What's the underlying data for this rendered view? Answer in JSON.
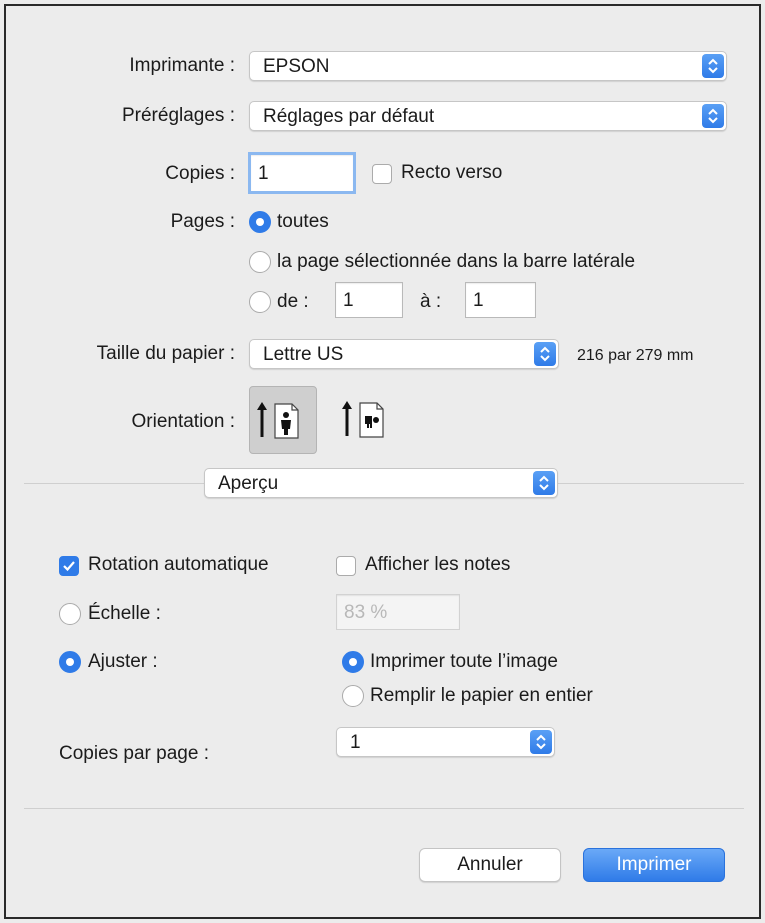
{
  "printer": {
    "label": "Imprimante :",
    "value": "EPSON"
  },
  "presets": {
    "label": "Préréglages :",
    "value": "Réglages par défaut"
  },
  "copies": {
    "label": "Copies :",
    "value": "1",
    "duplex_label": "Recto verso",
    "duplex_checked": false
  },
  "pages": {
    "label": "Pages :",
    "all_label": "toutes",
    "selected_label": "la page sélectionnée dans la barre latérale",
    "from_label": "de :",
    "from_value": "1",
    "to_label": "à :",
    "to_value": "1",
    "selected_option": "toutes"
  },
  "paper_size": {
    "label": "Taille du papier :",
    "value": "Lettre US",
    "dimensions": "216 par 279 mm"
  },
  "orientation": {
    "label": "Orientation :",
    "options": [
      "portrait",
      "landscape"
    ],
    "selected": "portrait"
  },
  "section": {
    "value": "Aperçu"
  },
  "preview": {
    "auto_rotate_label": "Rotation automatique",
    "auto_rotate_checked": true,
    "show_notes_label": "Afficher les notes",
    "show_notes_checked": false,
    "scale_label": "Échelle :",
    "scale_value": "83 %",
    "fit_label": "Ajuster :",
    "fit_selected": true,
    "print_entire_label": "Imprimer toute l’image",
    "fill_paper_label": "Remplir le papier en entier",
    "fit_mode_selected": "Imprimer toute l’image",
    "copies_per_page_label": "Copies par page :",
    "copies_per_page_value": "1"
  },
  "buttons": {
    "cancel": "Annuler",
    "print": "Imprimer"
  },
  "colors": {
    "accent": "#2f7be8",
    "background": "#ececec"
  }
}
